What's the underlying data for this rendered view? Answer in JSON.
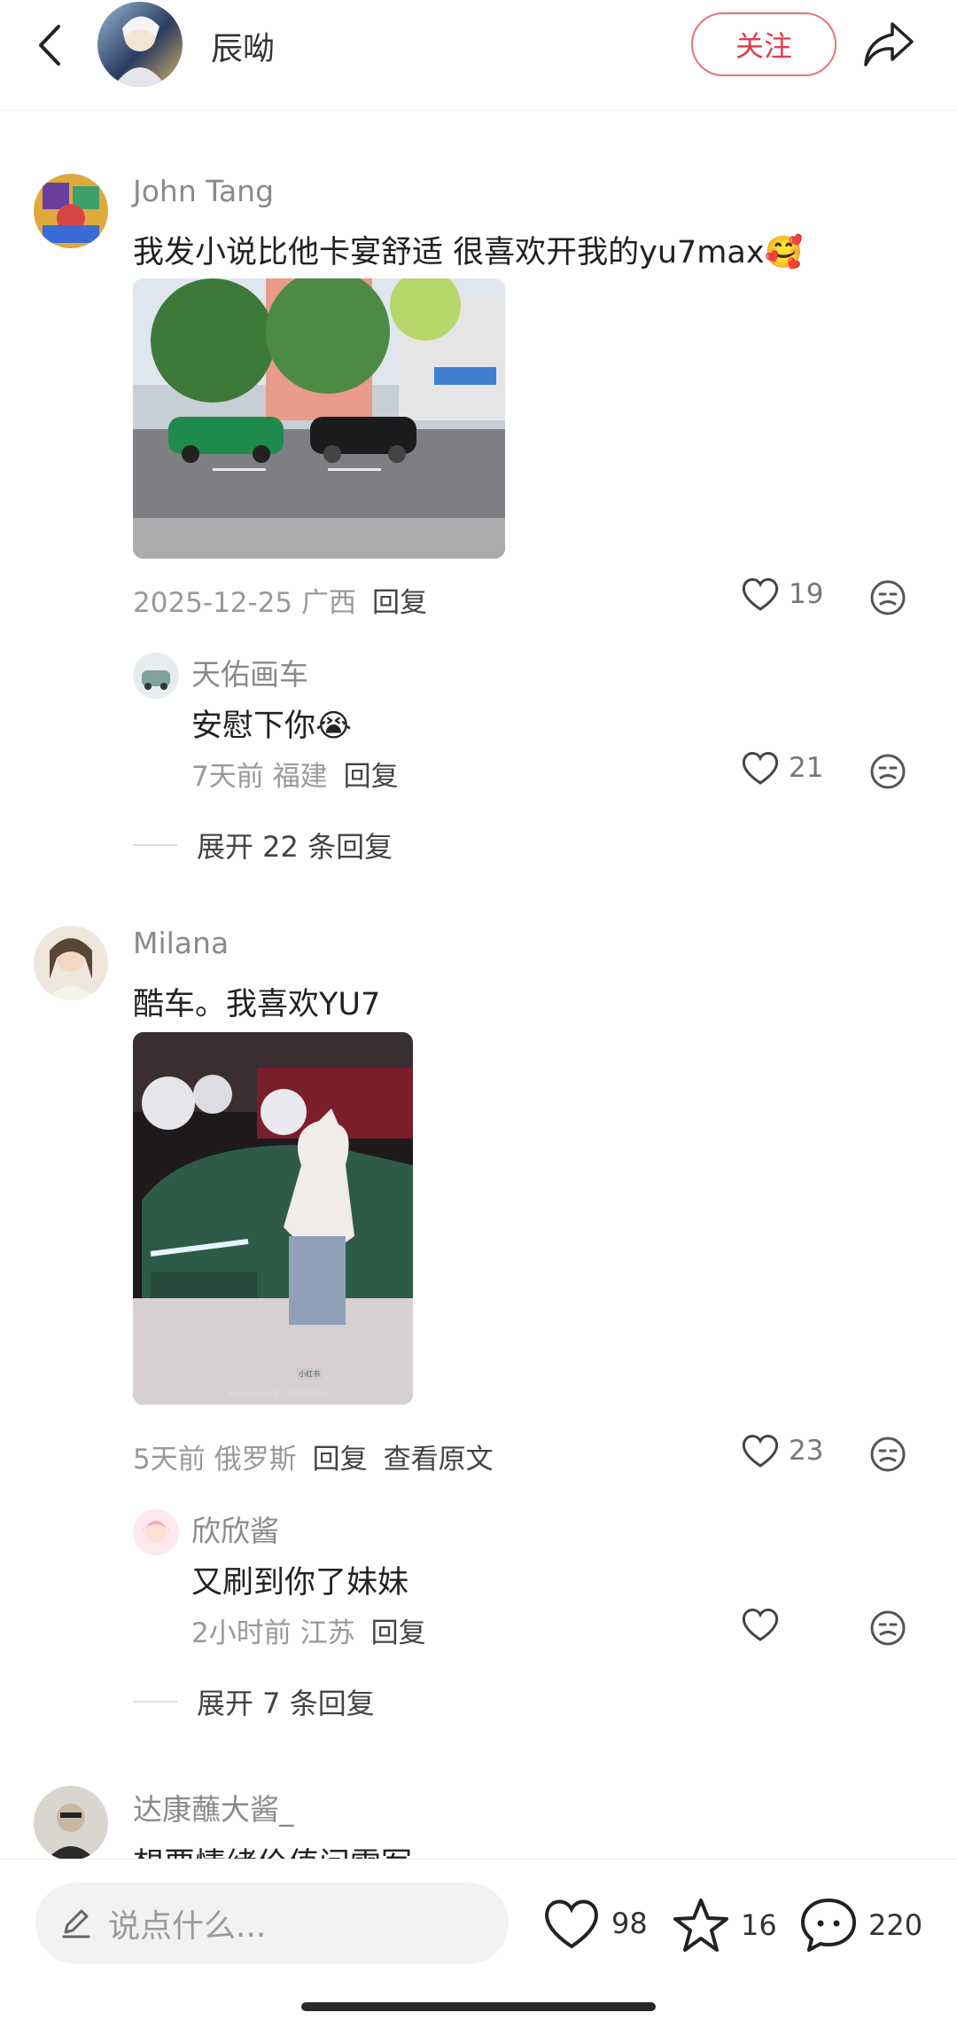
{
  "header": {
    "title": "辰呦",
    "follow_label": "关注"
  },
  "comments": [
    {
      "user": "John Tang",
      "text": "我发小说比他卡宴舒适 很喜欢开我的yu7max",
      "emoji": "🥰",
      "date": "2025-12-25",
      "location": "广西",
      "reply_label": "回复",
      "likes": "19",
      "replies": [
        {
          "user": "天佑画车",
          "text": "安慰下你",
          "emoji": "😭",
          "time": "7天前",
          "location": "福建",
          "reply_label": "回复",
          "likes": "21"
        }
      ],
      "expand_label": "展开 22 条回复"
    },
    {
      "user": "Milana",
      "text": "酷车。我喜欢YU7",
      "date": "5天前",
      "location": "俄罗斯",
      "reply_label": "回复",
      "view_original": "查看原文",
      "likes": "23",
      "image_watermark": "小红书",
      "image_id": "Moe redsate ID: 3304905567",
      "replies": [
        {
          "user": "欣欣酱",
          "text": "又刷到你了妹妹",
          "time": "2小时前",
          "location": "江苏",
          "reply_label": "回复",
          "likes": ""
        }
      ],
      "expand_label": "展开 7 条回复"
    },
    {
      "user": "达康蘸大酱_",
      "text": "想要情绪价值问雷军"
    }
  ],
  "bottom": {
    "placeholder": "说点什么...",
    "likes": "98",
    "stars": "16",
    "comments": "220"
  }
}
